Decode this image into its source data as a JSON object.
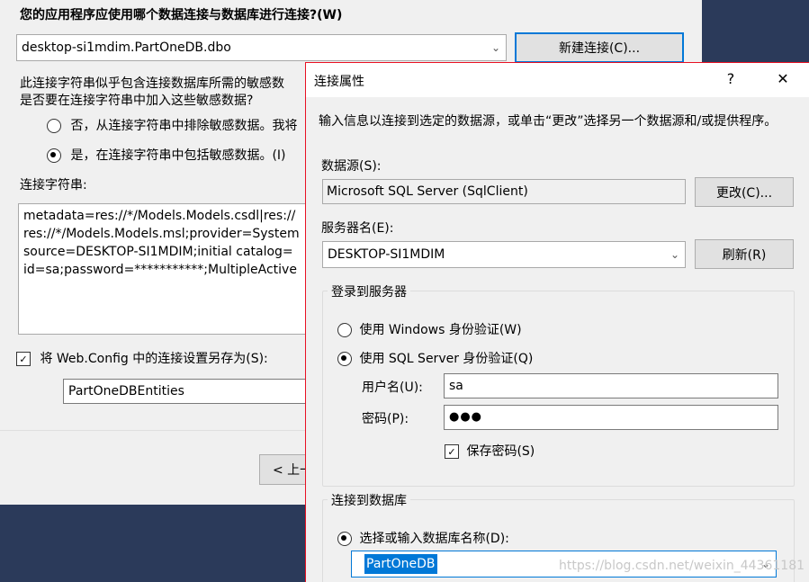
{
  "wizard": {
    "question": "您的应用程序应使用哪个数据连接与数据库进行连接?(W)",
    "connection_select": "desktop-si1mdim.PartOneDB.dbo",
    "new_connection_button": "新建连接(C)...",
    "sensitive_prompt_line1": "此连接字符串似乎包含连接数据库所需的敏感数",
    "sensitive_prompt_line2": "是否要在连接字符串中加入这些敏感数据?",
    "exclude_option": "否，从连接字符串中排除敏感数据。我将",
    "include_option": "是，在连接字符串中包括敏感数据。(I)",
    "connstr_label": "连接字符串:",
    "connstr_lines": [
      "metadata=res://*/Models.Models.csdl|res://",
      "res://*/Models.Models.msl;provider=System",
      "source=DESKTOP-SI1MDIM;initial catalog=",
      "id=sa;password=***********;MultipleActive"
    ],
    "save_config_label": "将 Web.Config 中的连接设置另存为(S):",
    "entities_name": "PartOneDBEntities",
    "prev_button": "< 上一"
  },
  "dialog": {
    "title": "连接属性",
    "help_glyph": "?",
    "close_glyph": "✕",
    "intro": "输入信息以连接到选定的数据源，或单击“更改”选择另一个数据源和/或提供程序。",
    "datasource_label": "数据源(S):",
    "datasource_value": "Microsoft SQL Server (SqlClient)",
    "change_button": "更改(C)...",
    "server_label": "服务器名(E):",
    "server_value": "DESKTOP-SI1MDIM",
    "refresh_button": "刷新(R)",
    "login_group": "登录到服务器",
    "windows_auth": "使用 Windows 身份验证(W)",
    "sql_auth": "使用 SQL Server 身份验证(Q)",
    "username_label": "用户名(U):",
    "username_value": "sa",
    "password_label": "密码(P):",
    "password_value": "●●●",
    "save_password": "保存密码(S)",
    "db_group": "连接到数据库",
    "select_db_option": "选择或输入数据库名称(D):",
    "db_value": "PartOneDB"
  },
  "watermark": "https://blog.csdn.net/weixin_44361181",
  "colors": {
    "accent": "#0078d7",
    "dialog_border": "#e81123",
    "backdrop": "#2b3a5a"
  }
}
